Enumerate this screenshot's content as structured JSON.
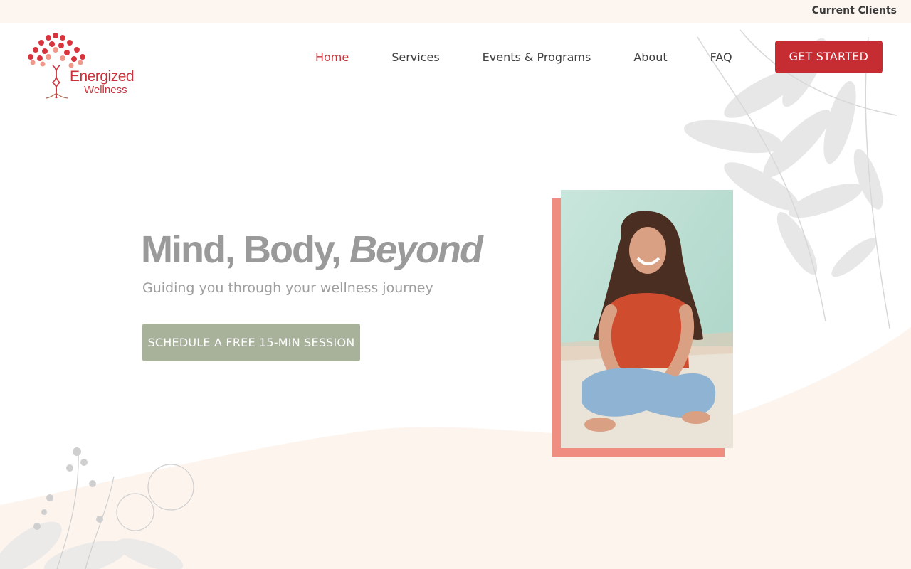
{
  "topbar": {
    "current_clients": "Current Clients"
  },
  "logo": {
    "line1": "Energized",
    "line2": "Wellness"
  },
  "nav": {
    "items": [
      {
        "label": "Home",
        "active": true
      },
      {
        "label": "Services"
      },
      {
        "label": "Events & Programs"
      },
      {
        "label": "About"
      },
      {
        "label": "FAQ"
      }
    ],
    "cta": "GET STARTED"
  },
  "hero": {
    "title_plain": "Mind, Body,",
    "title_italic": "Beyond",
    "subtitle": "Guiding you through your wellness journey",
    "cta": "SCHEDULE A FREE 15-MIN SESSION"
  },
  "colors": {
    "brand_red": "#c62d33",
    "sage": "#a8b19a",
    "coral_frame": "#ee8d80",
    "cream": "#fdf5f0"
  }
}
